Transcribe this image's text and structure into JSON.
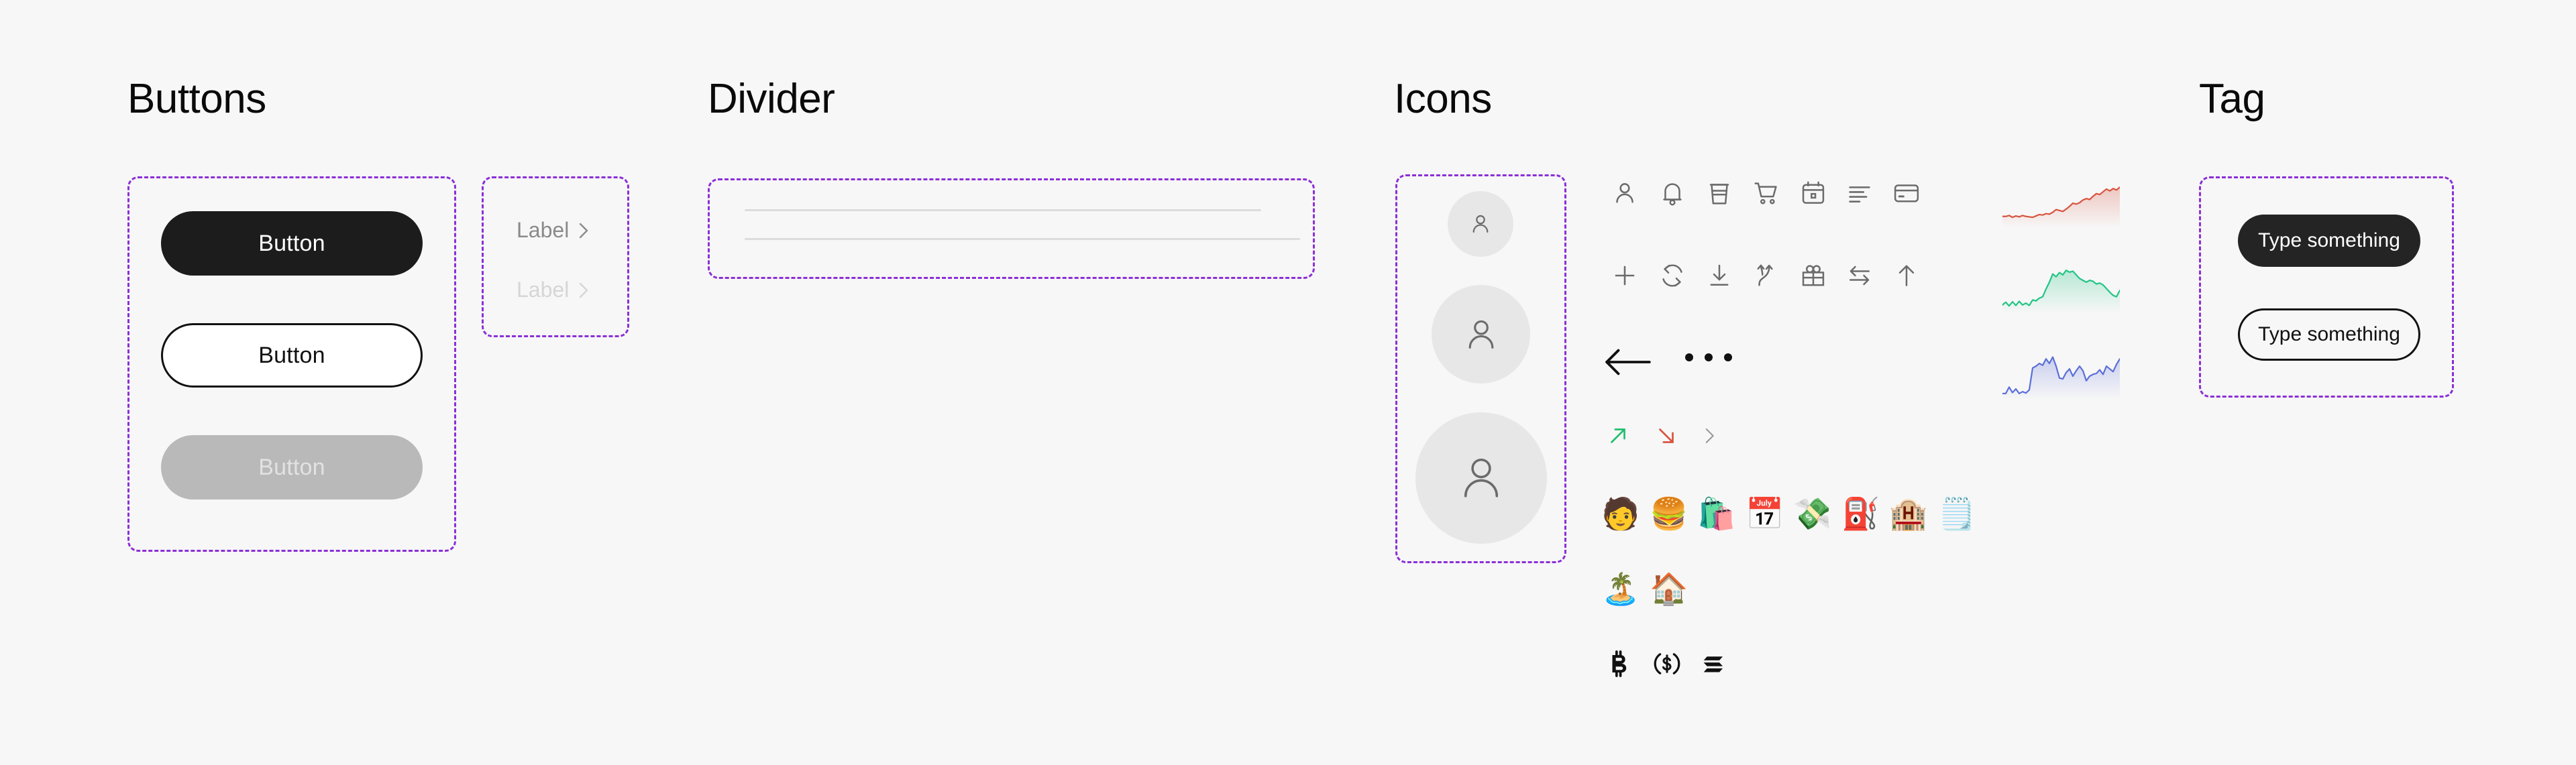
{
  "page": {
    "background": "#F7F7F7",
    "accent_dashed": "#8B2FD6"
  },
  "sections": {
    "buttons": {
      "title": "Buttons"
    },
    "divider": {
      "title": "Divider"
    },
    "icons": {
      "title": "Icons"
    },
    "tag": {
      "title": "Tag"
    }
  },
  "buttons": {
    "primary": {
      "label": "Button",
      "state": "default",
      "bg": "#1C1C1C",
      "fg": "#FFFFFF"
    },
    "secondary": {
      "label": "Button",
      "state": "outline",
      "bg": "#FFFFFF",
      "fg": "#111111"
    },
    "disabled": {
      "label": "Button",
      "state": "disabled",
      "bg": "#B9B9B9",
      "fg": "#E2E2E2"
    }
  },
  "label_links": [
    {
      "text": "Label",
      "chevron": "chevron-right-icon",
      "state": "default",
      "color": "#8A8A8A"
    },
    {
      "text": "Label",
      "chevron": "chevron-right-icon",
      "state": "disabled",
      "color": "#D6D6D6"
    }
  ],
  "dividers": [
    {
      "name": "divider-short",
      "color": "#DCDCDC"
    },
    {
      "name": "divider-long",
      "color": "#DCDCDC"
    }
  ],
  "avatars": [
    {
      "size": "small",
      "icon": "user-icon",
      "bg": "#E7E7E7"
    },
    {
      "size": "medium",
      "icon": "user-icon",
      "bg": "#E7E7E7"
    },
    {
      "size": "large",
      "icon": "user-icon",
      "bg": "#E7E7E7"
    }
  ],
  "icon_grid": {
    "stroke": "#6B6B6B",
    "row1": [
      "user-icon",
      "bell-icon",
      "coffee-cup-icon",
      "shopping-cart-icon",
      "calendar-icon",
      "text-align-left-icon",
      "credit-card-icon"
    ],
    "row2": [
      "plus-icon",
      "refresh-icon",
      "download-icon",
      "shuffle-icon",
      "gift-icon",
      "swap-arrows-icon",
      "arrow-up-icon"
    ]
  },
  "nav_icons": {
    "back": "arrow-left-icon",
    "more": "ellipsis-icon"
  },
  "trend_icons": [
    {
      "name": "arrow-up-right-icon",
      "color": "#1FBF6B"
    },
    {
      "name": "arrow-down-right-icon",
      "color": "#D9543F"
    },
    {
      "name": "chevron-right-icon",
      "color": "#9A9A9A"
    }
  ],
  "emoji_row1": [
    {
      "name": "person-emoji",
      "glyph": "🧑"
    },
    {
      "name": "hamburger-emoji",
      "glyph": "🍔"
    },
    {
      "name": "shopping-bags-emoji",
      "glyph": "🛍️"
    },
    {
      "name": "calendar-emoji",
      "glyph": "📅"
    },
    {
      "name": "money-wings-emoji",
      "glyph": "💸"
    },
    {
      "name": "fuel-pump-emoji",
      "glyph": "⛽"
    },
    {
      "name": "hotel-emoji",
      "glyph": "🏨"
    },
    {
      "name": "spiral-notepad-emoji",
      "glyph": "🗒️"
    }
  ],
  "emoji_row2": [
    {
      "name": "desert-island-emoji",
      "glyph": "🏝️"
    },
    {
      "name": "house-emoji",
      "glyph": "🏠"
    }
  ],
  "crypto_icons": [
    {
      "name": "bitcoin-icon",
      "symbol": "BTC"
    },
    {
      "name": "usdc-icon",
      "symbol": "USDC"
    },
    {
      "name": "solana-icon",
      "symbol": "SOL"
    }
  ],
  "tags": [
    {
      "label": "Type something",
      "variant": "filled",
      "bg": "#242424",
      "fg": "#FFFFFF"
    },
    {
      "label": "Type something",
      "variant": "outline",
      "bg": "transparent",
      "fg": "#111111"
    }
  ],
  "chart_data": [
    {
      "type": "line",
      "name": "sparkline-red",
      "title": "",
      "color": "#D9543F",
      "fill": "#D9543F",
      "xlabel": "",
      "ylabel": "",
      "grid": false,
      "legend": "none",
      "x": [
        0,
        1,
        2,
        3,
        4,
        5,
        6,
        7,
        8,
        9,
        10,
        11,
        12,
        13,
        14,
        15,
        16,
        17,
        18,
        19,
        20,
        21,
        22,
        23,
        24,
        25,
        26,
        27,
        28,
        29,
        30,
        31,
        32,
        33,
        34,
        35
      ],
      "values": [
        18,
        18,
        20,
        16,
        19,
        17,
        20,
        18,
        17,
        16,
        19,
        22,
        21,
        24,
        23,
        27,
        33,
        31,
        29,
        34,
        40,
        47,
        45,
        48,
        54,
        57,
        55,
        62,
        68,
        66,
        72,
        78,
        74,
        79,
        76,
        82
      ],
      "ylim": [
        0,
        100
      ]
    },
    {
      "type": "line",
      "name": "sparkline-green",
      "title": "",
      "color": "#22C585",
      "fill": "#22C585",
      "xlabel": "",
      "ylabel": "",
      "grid": false,
      "legend": "none",
      "x": [
        0,
        1,
        2,
        3,
        4,
        5,
        6,
        7,
        8,
        9,
        10,
        11,
        12,
        13,
        14,
        15,
        16,
        17,
        18,
        19,
        20,
        21,
        22,
        23,
        24,
        25,
        26,
        27,
        28,
        29,
        30,
        31,
        32,
        33,
        34,
        35
      ],
      "values": [
        12,
        18,
        10,
        19,
        11,
        20,
        12,
        16,
        11,
        23,
        21,
        27,
        30,
        47,
        62,
        80,
        74,
        83,
        78,
        88,
        84,
        86,
        78,
        70,
        66,
        62,
        66,
        64,
        58,
        60,
        56,
        48,
        40,
        33,
        30,
        44
      ],
      "ylim": [
        0,
        100
      ]
    },
    {
      "type": "line",
      "name": "sparkline-blue",
      "title": "",
      "color": "#5B6FD8",
      "fill": "#5B6FD8",
      "xlabel": "",
      "ylabel": "",
      "grid": false,
      "legend": "none",
      "x": [
        0,
        1,
        2,
        3,
        4,
        5,
        6,
        7,
        8,
        9,
        10,
        11,
        12,
        13,
        14,
        15,
        16,
        17,
        18,
        19,
        20,
        21,
        22,
        23,
        24,
        25,
        26,
        27,
        28,
        29,
        30,
        31,
        32,
        33,
        34,
        35
      ],
      "values": [
        6,
        6,
        20,
        8,
        16,
        6,
        10,
        7,
        14,
        62,
        66,
        72,
        68,
        82,
        72,
        86,
        66,
        40,
        38,
        52,
        60,
        44,
        56,
        66,
        56,
        34,
        44,
        48,
        50,
        58,
        48,
        66,
        60,
        54,
        70,
        82
      ],
      "ylim": [
        0,
        100
      ]
    }
  ]
}
